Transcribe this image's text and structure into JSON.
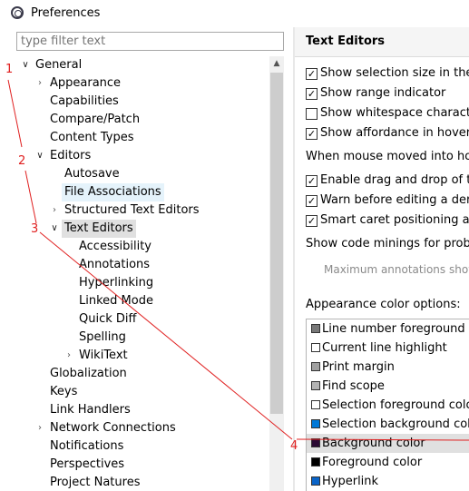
{
  "window": {
    "title": "Preferences"
  },
  "filter": {
    "placeholder": "type filter text"
  },
  "tree": {
    "general": "General",
    "appearance": "Appearance",
    "capabilities": "Capabilities",
    "compare_patch": "Compare/Patch",
    "content_types": "Content Types",
    "editors": "Editors",
    "autosave": "Autosave",
    "file_associations": "File Associations",
    "structured_text_editors": "Structured Text Editors",
    "text_editors": "Text Editors",
    "accessibility": "Accessibility",
    "annotations": "Annotations",
    "hyperlinking": "Hyperlinking",
    "linked_mode": "Linked Mode",
    "quick_diff": "Quick Diff",
    "spelling": "Spelling",
    "wikitext": "WikiText",
    "globalization": "Globalization",
    "keys": "Keys",
    "link_handlers": "Link Handlers",
    "network_connections": "Network Connections",
    "notifications": "Notifications",
    "perspectives": "Perspectives",
    "project_natures": "Project Natures"
  },
  "page": {
    "title": "Text Editors",
    "show_selection_size": "Show selection size in the sta",
    "show_range_indicator": "Show range indicator",
    "show_whitespace": "Show whitespace characters",
    "show_affordance": "Show affordance in hover or",
    "mouse_moved_label": "When mouse moved into hover",
    "enable_drag_drop": "Enable drag and drop of tex",
    "warn_before_editing": "Warn before editing a derive",
    "smart_caret": "Smart caret positioning at lin",
    "code_minings": "Show code minings for probler",
    "max_annotations": "Maximum annotations show",
    "appearance_color_options": "Appearance color options:",
    "colors": [
      {
        "label": "Line number foreground",
        "color": "#787878"
      },
      {
        "label": "Current line highlight",
        "color": "#ffffff"
      },
      {
        "label": "Print margin",
        "color": "#a0a0a0"
      },
      {
        "label": "Find scope",
        "color": "#b4b4b4"
      },
      {
        "label": "Selection foreground color",
        "color": "#ffffff"
      },
      {
        "label": "Selection background color",
        "color": "#0078d7"
      },
      {
        "label": "Background color",
        "color": "#2a0a33"
      },
      {
        "label": "Foreground color",
        "color": "#000000"
      },
      {
        "label": "Hyperlink",
        "color": "#0a64c8"
      }
    ]
  },
  "annotations": {
    "n1": "1",
    "n2": "2",
    "n3": "3",
    "n4": "4"
  }
}
